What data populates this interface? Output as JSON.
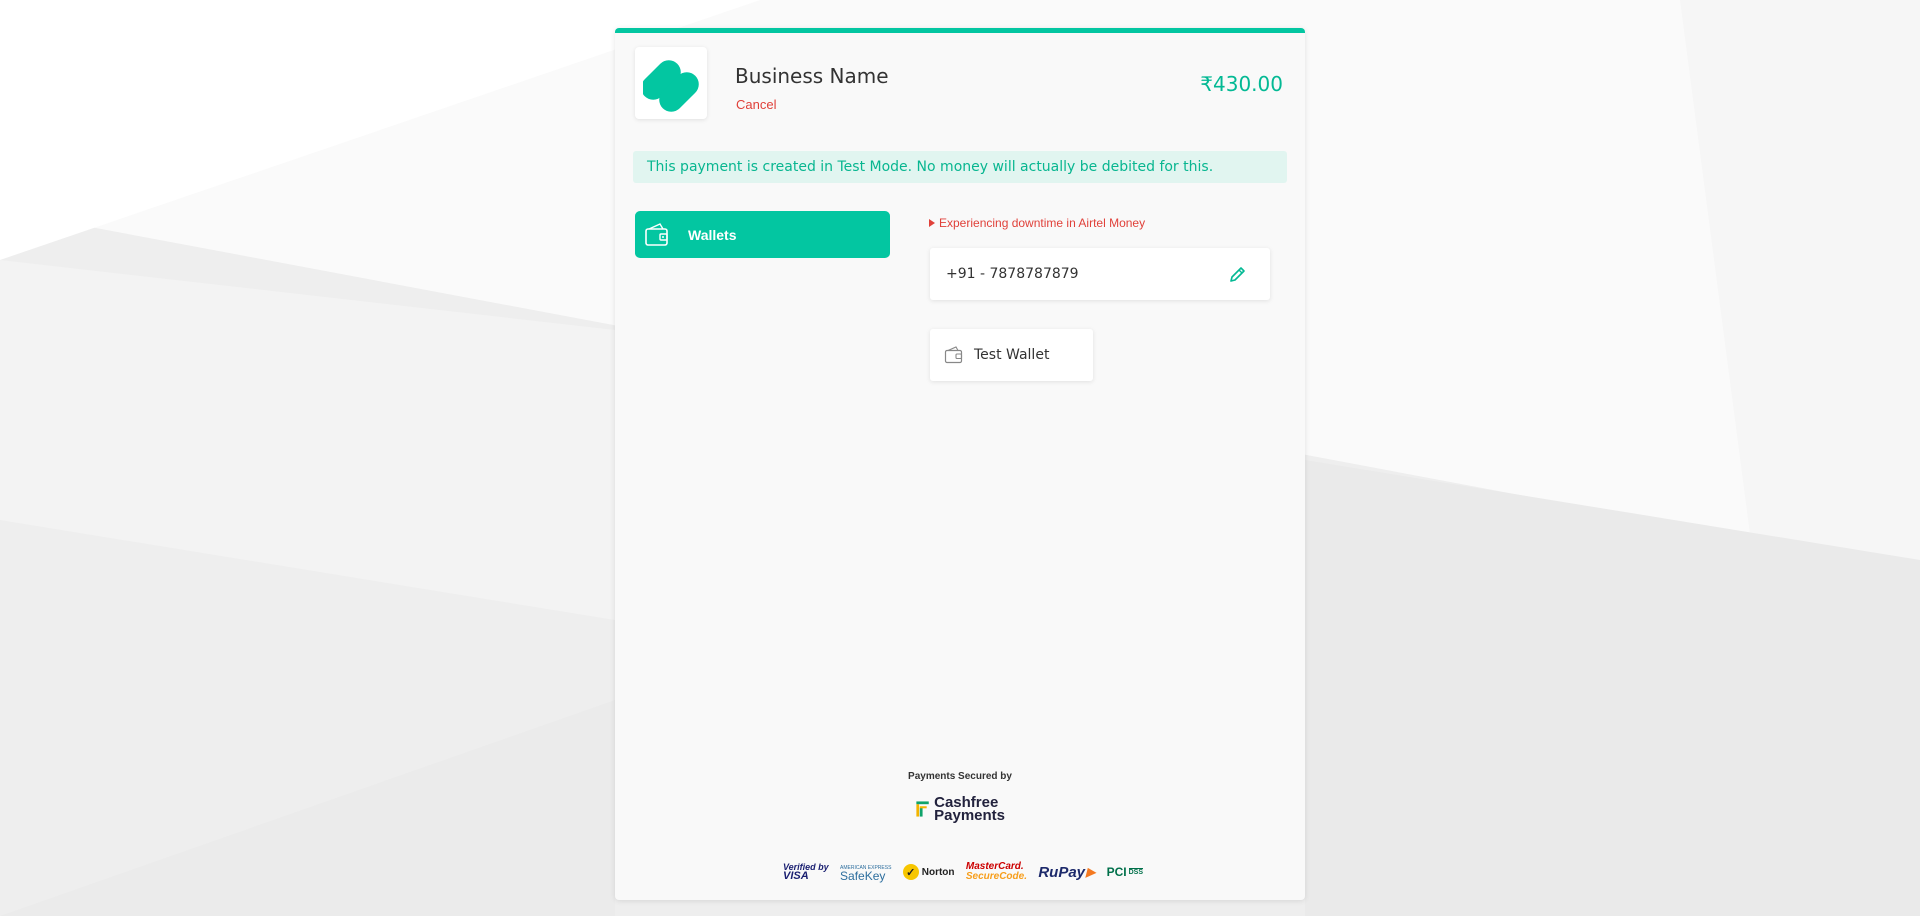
{
  "header": {
    "business_name": "Business Name",
    "cancel_label": "Cancel",
    "amount": "₹430.00"
  },
  "notice": {
    "test_mode": "This payment is created in Test Mode. No money will actually be debited for this."
  },
  "payment_methods": [
    {
      "label": "Wallets",
      "icon": "wallet-icon",
      "selected": true
    }
  ],
  "wallet_panel": {
    "downtime_message": "Experiencing downtime in Airtel Money",
    "phone_number": "+91 - 7878787879",
    "options": [
      {
        "label": "Test Wallet",
        "icon": "wallet-icon"
      }
    ]
  },
  "footer": {
    "secured_by": "Payments Secured by",
    "provider_line1": "Cashfree",
    "provider_line2": "Payments",
    "trust_badges": [
      {
        "line1": "Verified by",
        "line2": "VISA"
      },
      {
        "line1": "AMERICAN EXPRESS",
        "line2": "SafeKey"
      },
      {
        "line1": "Norton"
      },
      {
        "line1": "MasterCard.",
        "line2": "SecureCode."
      },
      {
        "line1": "RuPay"
      },
      {
        "line1": "PCI",
        "line2": "DSS"
      }
    ]
  },
  "colors": {
    "accent": "#03c6a1",
    "error": "#e0413a",
    "banner_bg": "#e1f5f0"
  }
}
